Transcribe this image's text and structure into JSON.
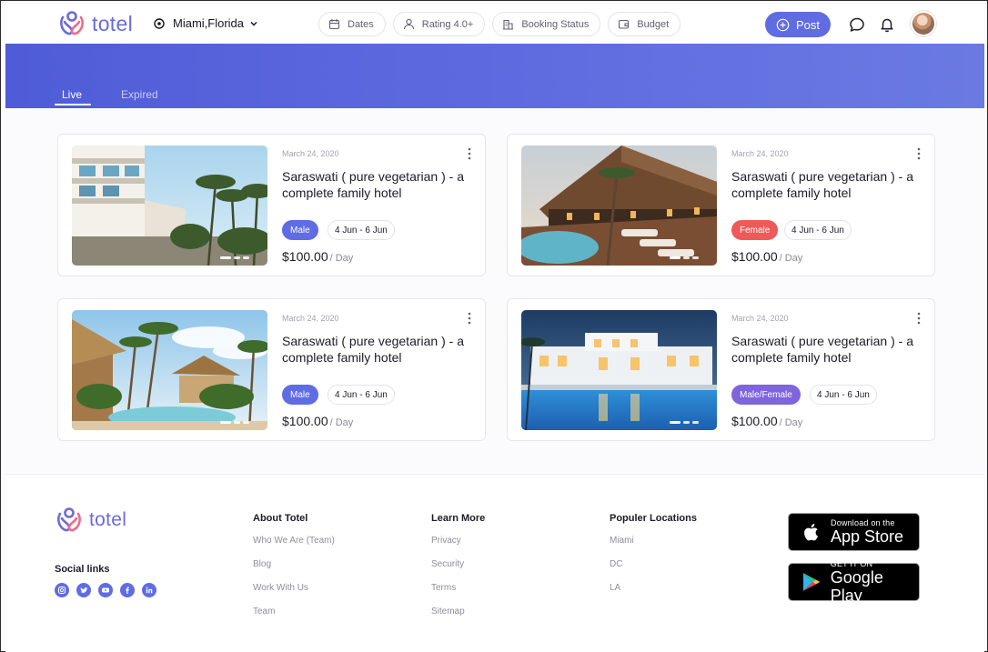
{
  "brand": {
    "name": "totel",
    "accent": "#5f6ce3"
  },
  "header": {
    "location": "Miami,Florida",
    "filters": [
      {
        "label": "Dates",
        "icon": "calendar-icon"
      },
      {
        "label": "Rating 4.0+",
        "icon": "user-icon"
      },
      {
        "label": "Booking Status",
        "icon": "building-icon"
      },
      {
        "label": "Budget",
        "icon": "wallet-icon"
      }
    ],
    "post_label": "Post"
  },
  "tabs": {
    "live": "Live",
    "expired": "Expired",
    "active": "Live"
  },
  "listings": [
    {
      "date": "March 24, 2020",
      "title": "Saraswati ( pure vegetarian ) - a complete family hotel",
      "gender": "Male",
      "gender_color": "#5f6ce3",
      "dates": "4 Jun - 6 Jun",
      "price": "$100.00",
      "per": "/ Day"
    },
    {
      "date": "March 24, 2020",
      "title": "Saraswati ( pure vegetarian ) - a complete family hotel",
      "gender": "Female",
      "gender_color": "#ee5a5a",
      "dates": "4 Jun - 6 Jun",
      "price": "$100.00",
      "per": "/ Day"
    },
    {
      "date": "March 24, 2020",
      "title": "Saraswati ( pure vegetarian ) - a complete family hotel",
      "gender": "Male",
      "gender_color": "#5f6ce3",
      "dates": "4 Jun - 6 Jun",
      "price": "$100.00",
      "per": "/ Day"
    },
    {
      "date": "March 24, 2020",
      "title": "Saraswati ( pure vegetarian ) - a complete family hotel",
      "gender": "Male/Female",
      "gender_color": "#7f64dc",
      "dates": "4 Jun - 6 Jun",
      "price": "$100.00",
      "per": "/ Day"
    }
  ],
  "footer": {
    "social_heading": "Social links",
    "social_icons": [
      "instagram-icon",
      "twitter-icon",
      "youtube-icon",
      "facebook-icon",
      "linkedin-icon"
    ],
    "about": {
      "heading": "About Totel",
      "links": [
        "Who We Are (Team)",
        "Blog",
        "Work With Us",
        "Team"
      ]
    },
    "learn": {
      "heading": "Learn More",
      "links": [
        "Privacy",
        "Security",
        "Terms",
        "Sitemap"
      ]
    },
    "locations": {
      "heading": "Populer Locations",
      "links": [
        "Miami",
        "DC",
        "LA"
      ]
    },
    "app_store": {
      "small": "Download on the",
      "big": "App Store"
    },
    "google_play": {
      "small": "GET IT ON",
      "big": "Google Play"
    }
  }
}
